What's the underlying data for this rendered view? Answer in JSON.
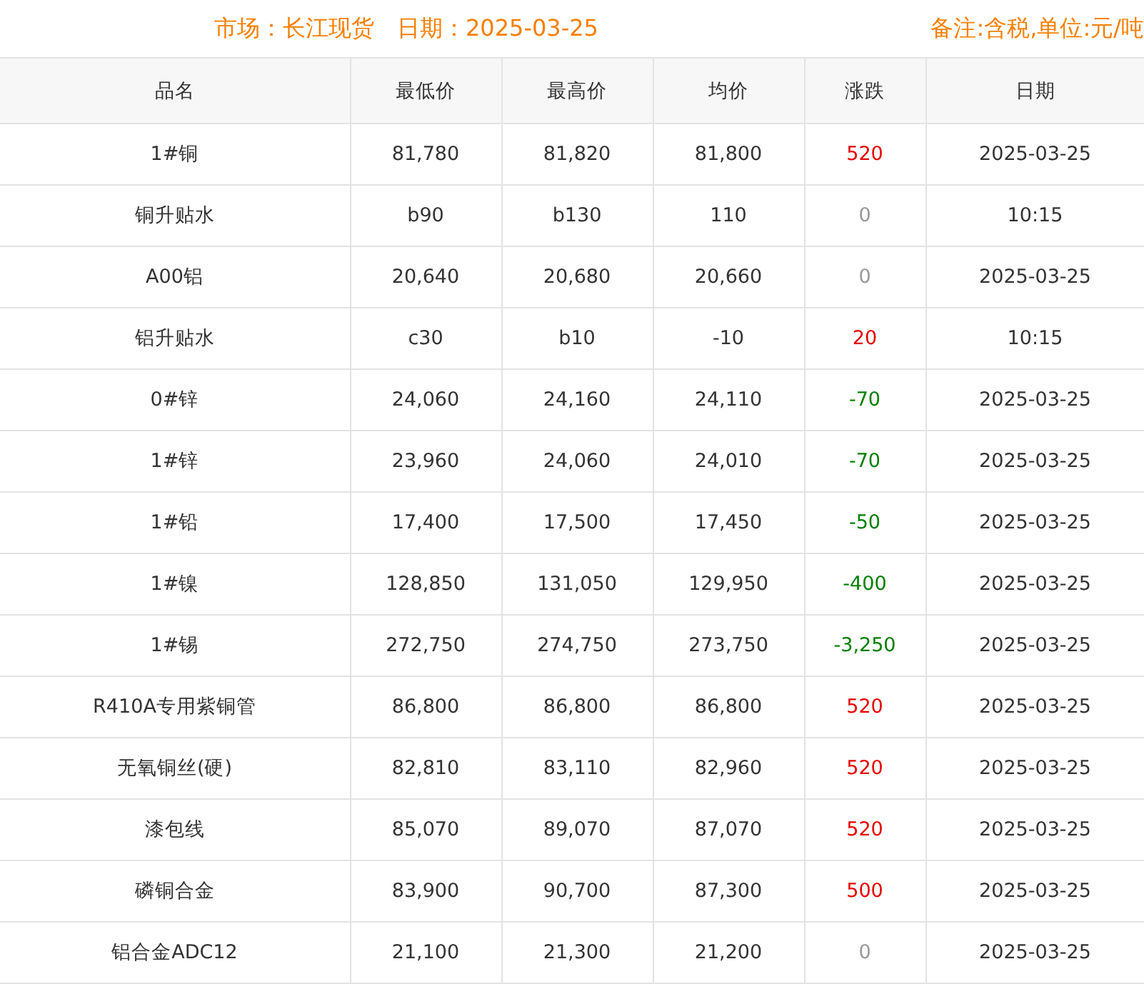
{
  "header": {
    "market": "市场：长江现货",
    "date": "日期：2025-03-25",
    "note": "备注:含税,单位:元/吨"
  },
  "table": {
    "columns": [
      "品名",
      "最低价",
      "最高价",
      "均价",
      "涨跌",
      "日期"
    ],
    "rows": [
      {
        "name": "1#铜",
        "low": "81,780",
        "high": "81,820",
        "avg": "81,800",
        "change": "520",
        "kind": "up",
        "date": "2025-03-25"
      },
      {
        "name": "铜升贴水",
        "low": "b90",
        "high": "b130",
        "avg": "110",
        "change": "0",
        "kind": "flat",
        "date": "10:15"
      },
      {
        "name": "A00铝",
        "low": "20,640",
        "high": "20,680",
        "avg": "20,660",
        "change": "0",
        "kind": "flat",
        "date": "2025-03-25"
      },
      {
        "name": "铝升贴水",
        "low": "c30",
        "high": "b10",
        "avg": "-10",
        "change": "20",
        "kind": "up",
        "date": "10:15"
      },
      {
        "name": "0#锌",
        "low": "24,060",
        "high": "24,160",
        "avg": "24,110",
        "change": "-70",
        "kind": "down",
        "date": "2025-03-25"
      },
      {
        "name": "1#锌",
        "low": "23,960",
        "high": "24,060",
        "avg": "24,010",
        "change": "-70",
        "kind": "down",
        "date": "2025-03-25"
      },
      {
        "name": "1#铅",
        "low": "17,400",
        "high": "17,500",
        "avg": "17,450",
        "change": "-50",
        "kind": "down",
        "date": "2025-03-25"
      },
      {
        "name": "1#镍",
        "low": "128,850",
        "high": "131,050",
        "avg": "129,950",
        "change": "-400",
        "kind": "down",
        "date": "2025-03-25"
      },
      {
        "name": "1#锡",
        "low": "272,750",
        "high": "274,750",
        "avg": "273,750",
        "change": "-3,250",
        "kind": "down",
        "date": "2025-03-25"
      },
      {
        "name": "R410A专用紫铜管",
        "low": "86,800",
        "high": "86,800",
        "avg": "86,800",
        "change": "520",
        "kind": "up",
        "date": "2025-03-25"
      },
      {
        "name": "无氧铜丝(硬)",
        "low": "82,810",
        "high": "83,110",
        "avg": "82,960",
        "change": "520",
        "kind": "up",
        "date": "2025-03-25"
      },
      {
        "name": "漆包线",
        "low": "85,070",
        "high": "89,070",
        "avg": "87,070",
        "change": "520",
        "kind": "up",
        "date": "2025-03-25"
      },
      {
        "name": "磷铜合金",
        "low": "83,900",
        "high": "90,700",
        "avg": "87,300",
        "change": "500",
        "kind": "up",
        "date": "2025-03-25"
      },
      {
        "name": "铝合金ADC12",
        "low": "21,100",
        "high": "21,300",
        "avg": "21,200",
        "change": "0",
        "kind": "flat",
        "date": "2025-03-25"
      }
    ]
  }
}
